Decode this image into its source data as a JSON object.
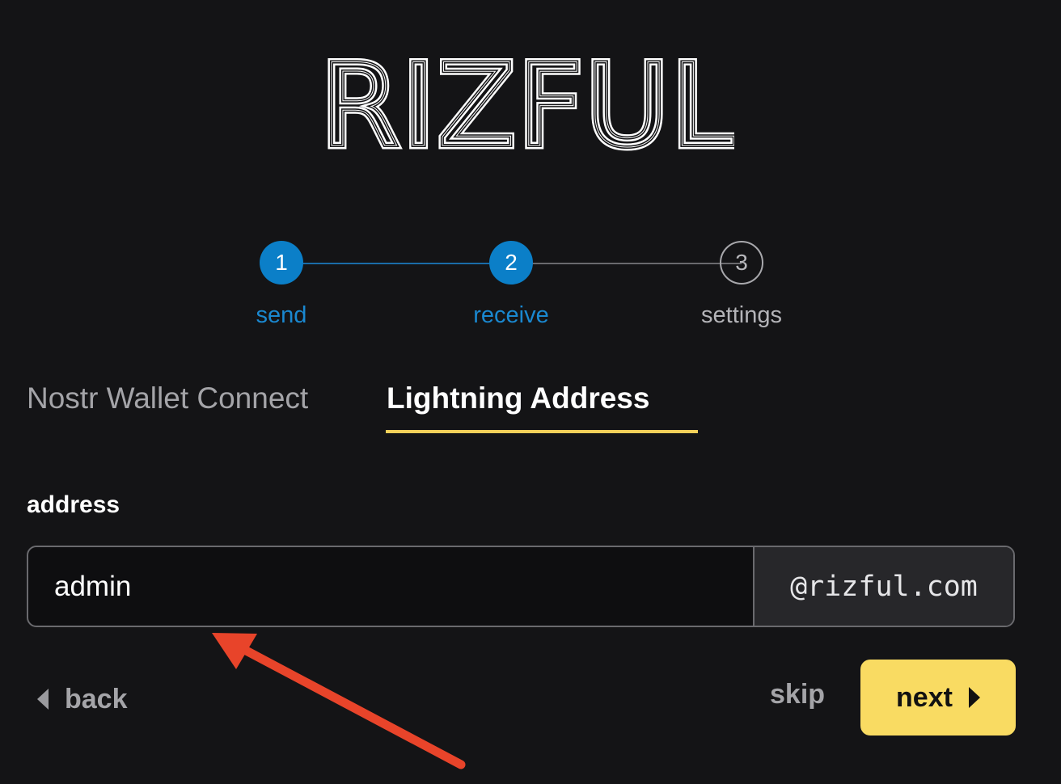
{
  "brand": {
    "logo_text": "RIZFUL"
  },
  "stepper": {
    "steps": [
      {
        "number": "1",
        "label": "send",
        "state": "done"
      },
      {
        "number": "2",
        "label": "receive",
        "state": "done"
      },
      {
        "number": "3",
        "label": "settings",
        "state": "todo"
      }
    ]
  },
  "tabs": [
    {
      "label": "Nostr Wallet Connect",
      "active": false
    },
    {
      "label": "Lightning Address",
      "active": true
    }
  ],
  "form": {
    "address_label": "address",
    "address_value": "admin",
    "address_suffix": "@rizful.com"
  },
  "actions": {
    "back_label": "back",
    "skip_label": "skip",
    "next_label": "next"
  },
  "colors": {
    "background": "#141416",
    "step_active": "#0b7fc8",
    "tab_underline": "#f4d15a",
    "next_button": "#f9db62",
    "annotation_arrow": "#e8442a"
  },
  "icons": {
    "back": "chevron-left-icon",
    "next": "chevron-right-icon"
  }
}
